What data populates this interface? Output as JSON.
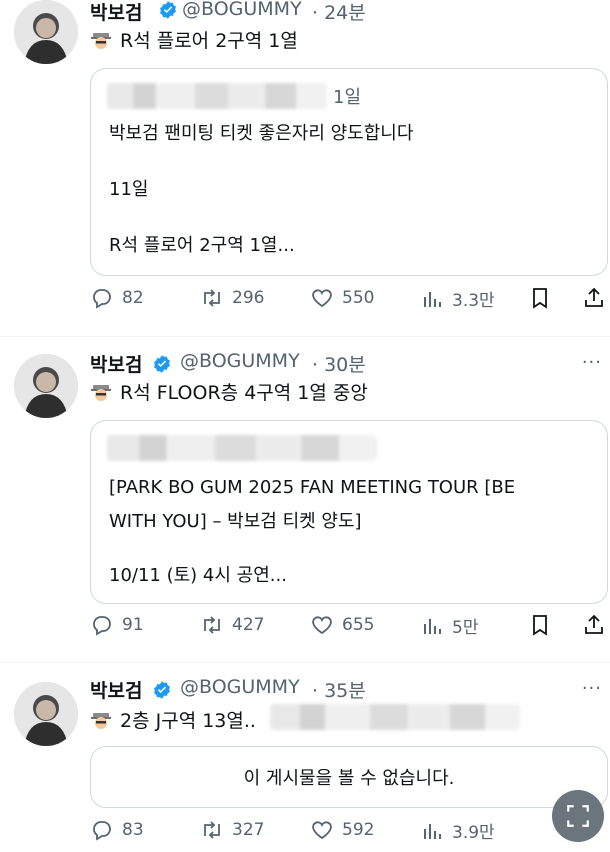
{
  "tweets": [
    {
      "name": "박보검",
      "handle": "@BOGUMMY",
      "time": "· 24분",
      "text": "R석 플로어 2구역 1열",
      "quote": {
        "time": "1일",
        "lines": [
          "박보검 팬미팅 티켓 좋은자리 양도합니다",
          "11일",
          "R석 플로어 2구역 1열..."
        ]
      },
      "stats": {
        "replies": "82",
        "reposts": "296",
        "likes": "550",
        "views": "3.3만"
      }
    },
    {
      "name": "박보검",
      "handle": "@BOGUMMY",
      "time": "· 30분",
      "text": "R석 FLOOR층 4구역 1열 중앙",
      "quote": {
        "lines": [
          " [PARK BO GUM 2025 FAN MEETING TOUR [BE",
          "WITH YOU] – 박보검 티켓 양도]",
          "10/11 (토) 4시 공연..."
        ]
      },
      "stats": {
        "replies": "91",
        "reposts": "427",
        "likes": "655",
        "views": "5만"
      }
    },
    {
      "name": "박보검",
      "handle": "@BOGUMMY",
      "time": "· 35분",
      "text": "2층 J구역 13열..",
      "quote": {
        "unavailable": "이 게시물을 볼 수 없습니다."
      },
      "stats": {
        "replies": "83",
        "reposts": "327",
        "likes": "592",
        "views": "3.9만"
      }
    }
  ],
  "colors": {
    "verified": "#1d9bf0",
    "secondary_text": "#536471",
    "border": "#cfd9de"
  },
  "icons": [
    "reply-icon",
    "repost-icon",
    "like-icon",
    "views-icon",
    "bookmark-icon",
    "share-icon",
    "spy-emoji-icon",
    "verified-badge-icon",
    "more-icon",
    "scan-icon"
  ]
}
